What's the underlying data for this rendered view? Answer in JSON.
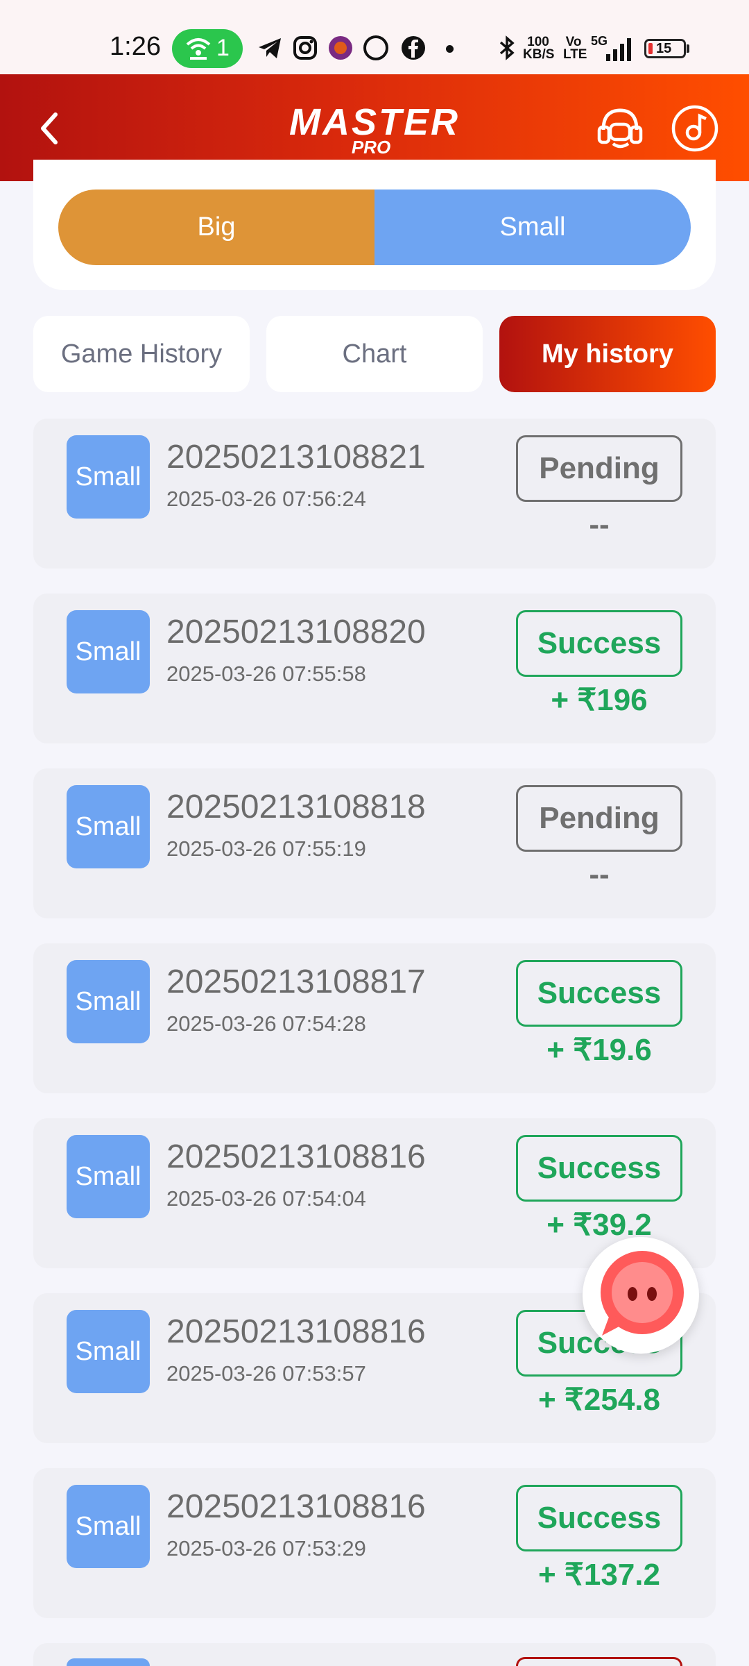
{
  "status_bar": {
    "time": "1:26",
    "hotspot_count": "1",
    "net_speed_top": "100",
    "net_speed_bottom": "KB/S",
    "volte_top": "Vo",
    "volte_bottom": "LTE",
    "network": "5G",
    "battery_level": "15"
  },
  "header": {
    "logo_main": "MASTER",
    "logo_sub": "PRO"
  },
  "bet_toggle": {
    "big_label": "Big",
    "small_label": "Small"
  },
  "tabs": [
    {
      "label": "Game History",
      "active": false
    },
    {
      "label": "Chart",
      "active": false
    },
    {
      "label": "My history",
      "active": true
    }
  ],
  "history": [
    {
      "bet": "Small",
      "issue": "20250213108821",
      "time": "2025-03-26 07:56:24",
      "status": "Pending",
      "amount": "--"
    },
    {
      "bet": "Small",
      "issue": "20250213108820",
      "time": "2025-03-26 07:55:58",
      "status": "Success",
      "amount": "+ ₹196"
    },
    {
      "bet": "Small",
      "issue": "20250213108818",
      "time": "2025-03-26 07:55:19",
      "status": "Pending",
      "amount": "--"
    },
    {
      "bet": "Small",
      "issue": "20250213108817",
      "time": "2025-03-26 07:54:28",
      "status": "Success",
      "amount": "+ ₹19.6"
    },
    {
      "bet": "Small",
      "issue": "20250213108816",
      "time": "2025-03-26 07:54:04",
      "status": "Success",
      "amount": "+ ₹39.2"
    },
    {
      "bet": "Small",
      "issue": "20250213108816",
      "time": "2025-03-26 07:53:57",
      "status": "Success",
      "amount": "+ ₹254.8"
    },
    {
      "bet": "Small",
      "issue": "20250213108816",
      "time": "2025-03-26 07:53:29",
      "status": "Success",
      "amount": "+ ₹137.2"
    }
  ],
  "colors": {
    "header_start": "#b2120f",
    "header_end": "#ff4e00",
    "big": "#de9437",
    "small": "#6ea4f2",
    "success": "#1fa65a",
    "pending": "#6f6f6f"
  }
}
